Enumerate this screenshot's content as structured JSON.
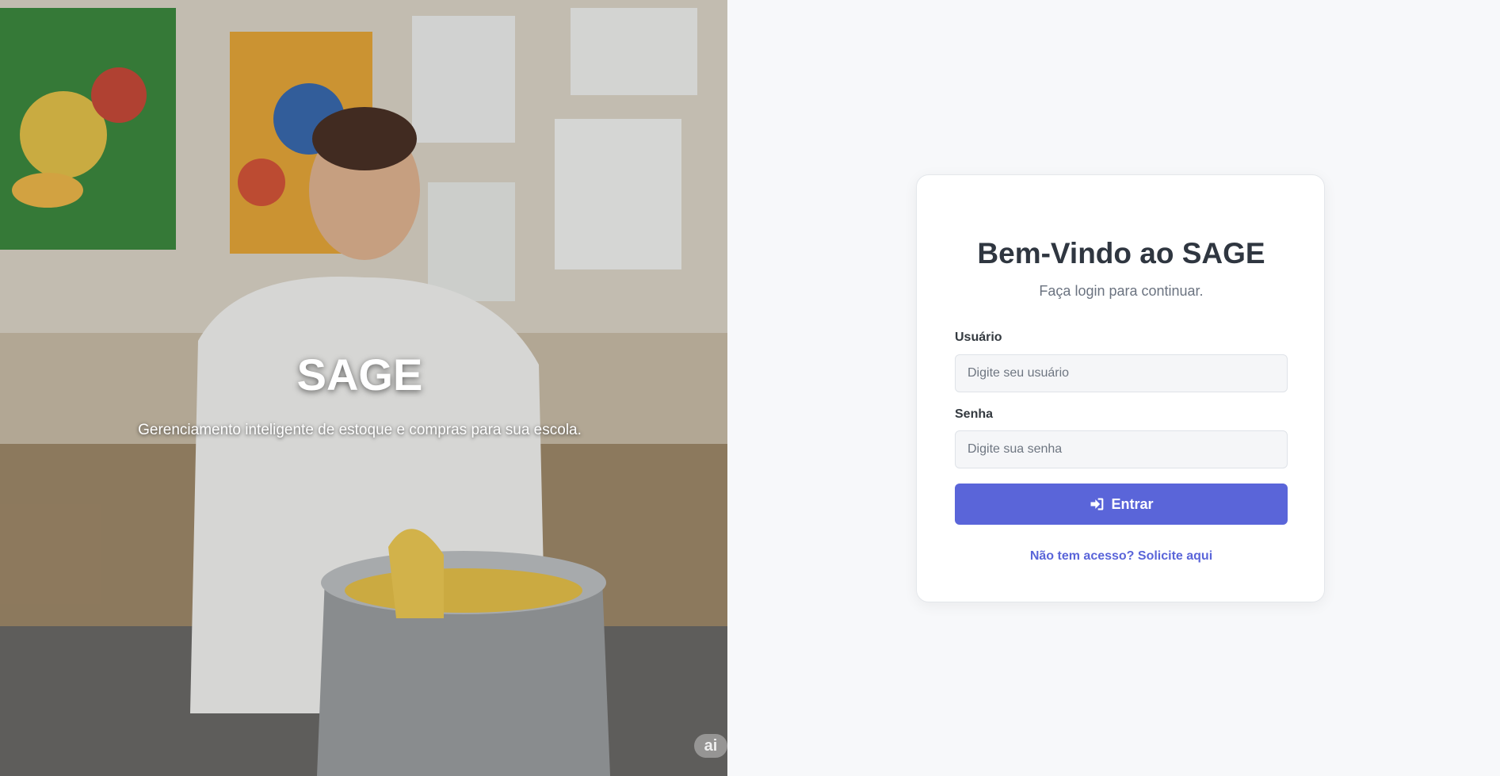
{
  "hero": {
    "title": "SAGE",
    "subtitle": "Gerenciamento inteligente de estoque e compras para sua escola.",
    "badge": "ai"
  },
  "login": {
    "title": "Bem-Vindo ao SAGE",
    "subtitle": "Faça login para continuar.",
    "username_label": "Usuário",
    "username_placeholder": "Digite seu usuário",
    "password_label": "Senha",
    "password_placeholder": "Digite sua senha",
    "submit_label": "Entrar",
    "submit_icon": "sign-in-icon",
    "request_link": "Não tem acesso? Solicite aqui"
  },
  "colors": {
    "accent": "#5a65d9",
    "background": "#f7f8fa",
    "title": "#2f3640"
  }
}
